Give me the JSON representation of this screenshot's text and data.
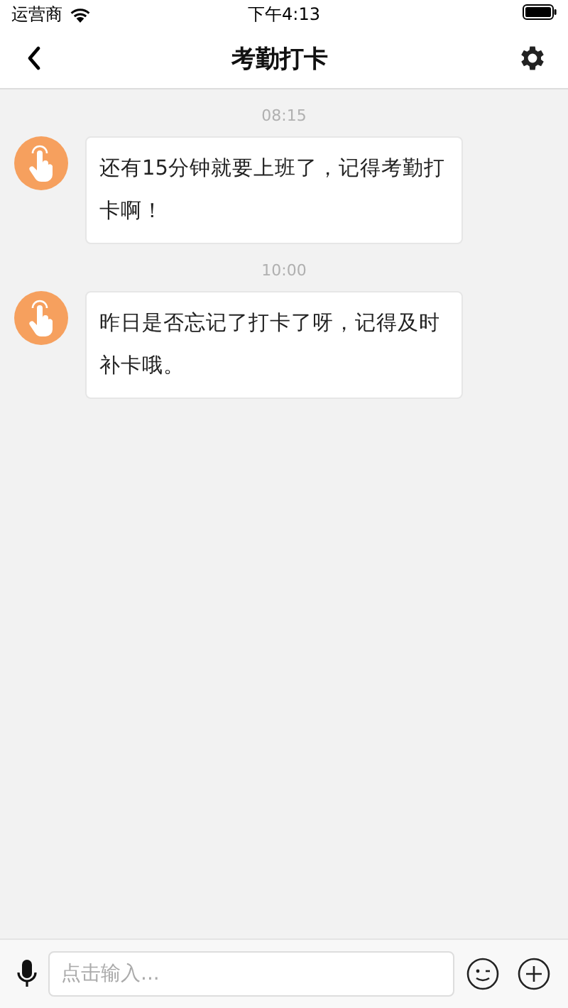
{
  "status_bar": {
    "carrier": "运营商",
    "time": "下午4:13"
  },
  "nav_bar": {
    "title": "考勤打卡"
  },
  "messages": [
    {
      "time": "08:15",
      "text": "还有15分钟就要上班了，记得考勤打卡啊！"
    },
    {
      "time": "10:00",
      "text": "昨日是否忘记了打卡了呀，记得及时补卡哦。"
    }
  ],
  "input_bar": {
    "placeholder": "点击输入..."
  }
}
